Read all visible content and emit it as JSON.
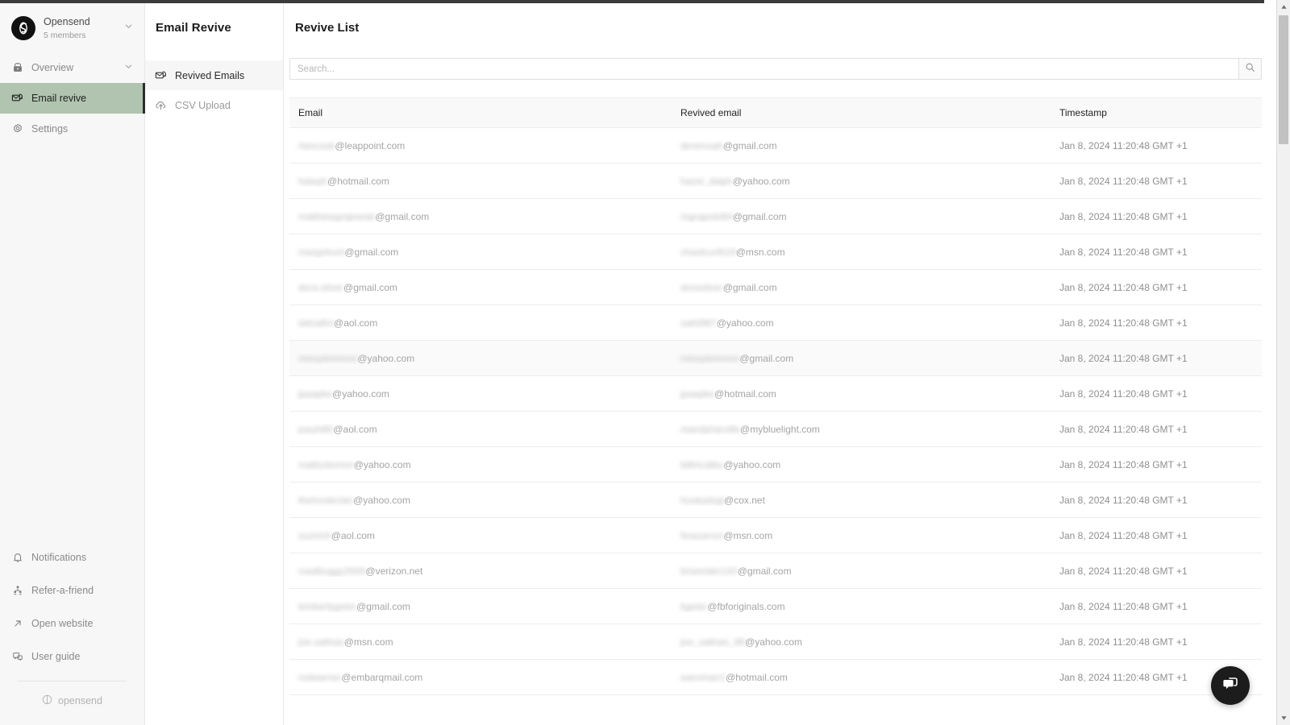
{
  "sidebar": {
    "org": {
      "name": "Opensend",
      "members": "5 members",
      "chevron_icon": "chevron-down-icon",
      "logo_icon": "opensend-logo-icon"
    },
    "items": [
      {
        "label": "Overview",
        "icon": "overview-icon",
        "active": false,
        "chevron": true
      },
      {
        "label": "Email revive",
        "icon": "email-revive-icon",
        "active": true,
        "chevron": false
      },
      {
        "label": "Settings",
        "icon": "gear-icon",
        "active": false,
        "chevron": false
      }
    ],
    "bottom_items": [
      {
        "label": "Notifications",
        "icon": "bell-icon"
      },
      {
        "label": "Refer-a-friend",
        "icon": "refer-friend-icon"
      },
      {
        "label": "Open website",
        "icon": "external-link-icon"
      },
      {
        "label": "User guide",
        "icon": "user-guide-icon"
      }
    ],
    "footer": {
      "label": "opensend",
      "icon": "opensend-mark-icon"
    }
  },
  "subnav": {
    "title": "Email Revive",
    "items": [
      {
        "label": "Revived Emails",
        "icon": "revived-emails-icon",
        "active": true
      },
      {
        "label": "CSV Upload",
        "icon": "upload-cloud-icon",
        "active": false
      }
    ]
  },
  "main": {
    "title": "Revive List",
    "search": {
      "placeholder": "Search...",
      "value": "",
      "button_icon": "search-icon"
    },
    "table": {
      "columns": [
        "Email",
        "Revived email",
        "Timestamp"
      ],
      "rows": [
        {
          "email": "rlancook@leappoint.com",
          "revived": "devenoah@gmail.com",
          "timestamp": "Jan 8, 2024 11:20:48 GMT +1",
          "hover": false
        },
        {
          "email": "haleph@hotmail.com",
          "revived": "hazel_dalph@yahoo.com",
          "timestamp": "Jan 8, 2024 11:20:48 GMT +1",
          "hover": false
        },
        {
          "email": "matthewgrajewski@gmail.com",
          "revived": "mgrajeski84@gmail.com",
          "timestamp": "Jan 8, 2024 11:20:48 GMT +1",
          "hover": false
        },
        {
          "email": "margohunt@gmail.com",
          "revived": "chastcurt519@msn.com",
          "timestamp": "Jan 8, 2024 11:20:48 GMT +1",
          "hover": false
        },
        {
          "email": "dora.oliver@gmail.com",
          "revived": "doraoliver@gmail.com",
          "timestamp": "Jan 8, 2024 11:20:48 GMT +1",
          "hover": false
        },
        {
          "email": "latinafini@aol.com",
          "revived": "saihi987@yahoo.com",
          "timestamp": "Jan 8, 2024 11:20:48 GMT +1",
          "hover": false
        },
        {
          "email": "missylemmon@yahoo.com",
          "revived": "missylemmon@gmail.com",
          "timestamp": "Jan 8, 2024 11:20:48 GMT +1",
          "hover": true
        },
        {
          "email": "jpaapke@yahoo.com",
          "revived": "jpaapke@hotmail.com",
          "timestamp": "Jan 8, 2024 11:20:48 GMT +1",
          "hover": false
        },
        {
          "email": "joeyhill0@aol.com",
          "revived": "mandyharville@mybluelight.com",
          "timestamp": "Jan 8, 2024 11:20:48 GMT +1",
          "hover": false
        },
        {
          "email": "mattsolomon@yahoo.com",
          "revived": "billmcalbu@yahoo.com",
          "timestamp": "Jan 8, 2024 11:20:48 GMT +1",
          "hover": false
        },
        {
          "email": "thehooleclan@yahoo.com",
          "revived": "huskydogl@cox.net",
          "timestamp": "Jan 8, 2024 11:20:48 GMT +1",
          "hover": false
        },
        {
          "email": "suzirich@aol.com",
          "revived": "finazarron@msn.com",
          "timestamp": "Jan 8, 2024 11:20:48 GMT +1",
          "hover": false
        },
        {
          "email": "roadbuggy2000@verizon.net",
          "revived": "brianrider143@gmail.com",
          "timestamp": "Jan 8, 2024 11:20:48 GMT +1",
          "hover": false
        },
        {
          "email": "kimberlygeter@gmail.com",
          "revived": "kgeter@fbforiginals.com",
          "timestamp": "Jan 8, 2024 11:20:48 GMT +1",
          "hover": false
        },
        {
          "email": "joe.salinas@msn.com",
          "revived": "joe_salinas_89@yahoo.com",
          "timestamp": "Jan 8, 2024 11:20:48 GMT +1",
          "hover": false
        },
        {
          "email": "mdwarner@embarqmail.com",
          "revived": "warnman1@hotmail.com",
          "timestamp": "Jan 8, 2024 11:20:48 GMT +1",
          "hover": false
        }
      ]
    }
  },
  "chat": {
    "icon": "chat-bubble-icon"
  },
  "scrollbar": {
    "up_icon": "scroll-up-arrow-icon",
    "down_icon": "scroll-down-arrow-icon"
  },
  "colors": {
    "accent_active": "#b0c4b0",
    "sidebar_bg": "#f7f7f7",
    "chat_fab": "#1c1c1c"
  }
}
